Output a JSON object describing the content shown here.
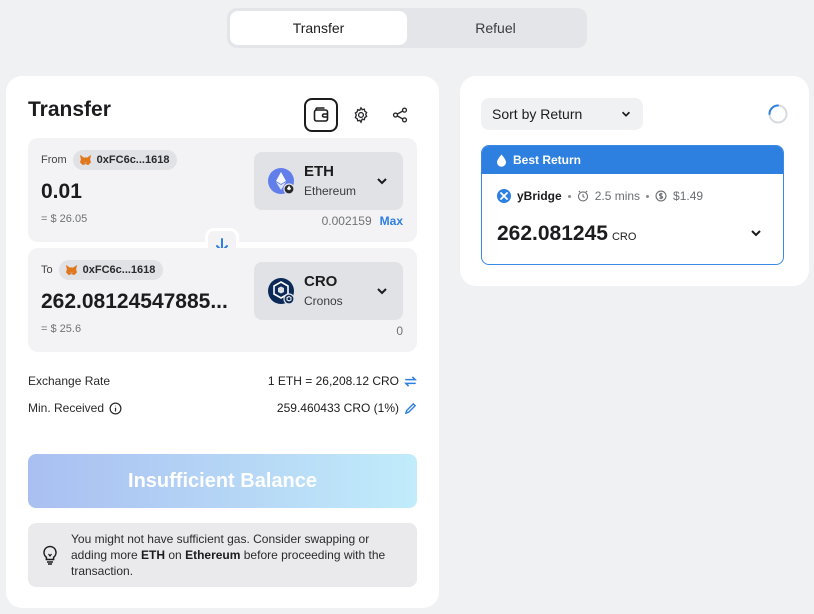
{
  "tabs": [
    {
      "label": "Transfer",
      "active": true
    },
    {
      "label": "Refuel",
      "active": false
    }
  ],
  "transfer": {
    "title": "Transfer",
    "icons": {
      "wallet": "wallet-icon",
      "settings": "gear-icon",
      "share": "share-icon"
    },
    "from": {
      "label": "From",
      "address": "0xFC6c...1618",
      "amount": "0.01",
      "usd": "= $ 26.05",
      "token": {
        "symbol": "ETH",
        "chain": "Ethereum"
      },
      "balance": "0.002159",
      "max_label": "Max"
    },
    "to": {
      "label": "To",
      "address": "0xFC6c...1618",
      "amount": "262.08124547885...",
      "usd": "= $ 25.6",
      "token": {
        "symbol": "CRO",
        "chain": "Cronos"
      },
      "balance": "0"
    },
    "exchange_rate": {
      "label": "Exchange Rate",
      "value": "1 ETH = 26,208.12 CRO"
    },
    "min_received": {
      "label": "Min. Received",
      "value": "259.460433 CRO (1%)"
    },
    "action_button": "Insufficient Balance",
    "gas_note": {
      "part1": "You might not have sufficient gas. Consider swapping or adding more ",
      "token": "ETH",
      "part2": " on ",
      "chain": "Ethereum",
      "part3": " before proceeding with the transaction."
    }
  },
  "routes": {
    "sort_label": "Sort by Return",
    "best": {
      "header": "Best Return",
      "bridge": "yBridge",
      "time": "2.5 mins",
      "fee": "$1.49",
      "amount": "262.081245",
      "unit": "CRO"
    }
  },
  "colors": {
    "accent": "#2d7fe0",
    "eth": "#627eea",
    "cro": "#0c2a57",
    "button_gradient_start": "#a9bff1",
    "button_gradient_end": "#c1ecfb"
  }
}
